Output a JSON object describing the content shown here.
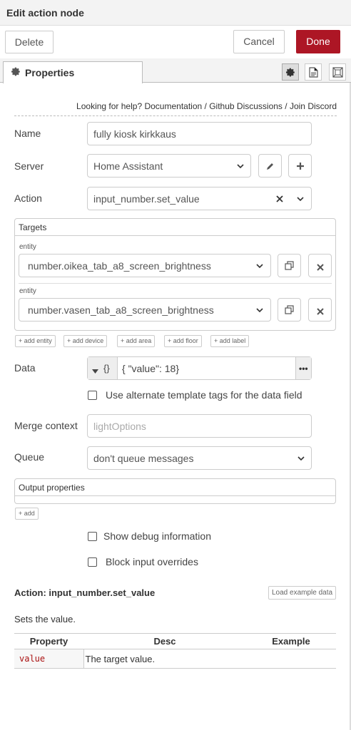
{
  "window": {
    "title": "Edit action node"
  },
  "toolbar": {
    "delete_label": "Delete",
    "cancel_label": "Cancel",
    "done_label": "Done"
  },
  "tabs": {
    "properties_label": "Properties"
  },
  "help": {
    "prefix": "Looking for help?",
    "documentation": "Documentation",
    "sep1": "/",
    "github": "Github Discussions",
    "sep2": "/",
    "discord": "Join Discord"
  },
  "form": {
    "name_label": "Name",
    "name_value": "fully kiosk kirkkaus",
    "server_label": "Server",
    "server_value": "Home Assistant",
    "action_label": "Action",
    "action_value": "input_number.set_value"
  },
  "targets": {
    "title": "Targets",
    "entities": [
      {
        "label": "entity",
        "value": "number.oikea_tab_a8_screen_brightness"
      },
      {
        "label": "entity",
        "value": "number.vasen_tab_a8_screen_brightness"
      }
    ],
    "add_buttons": [
      "add entity",
      "add device",
      "add area",
      "add floor",
      "add label"
    ]
  },
  "data_field": {
    "label": "Data",
    "type_symbol": "{}",
    "value": "{ \"value\": 18}",
    "alt_template_label": "Use alternate template tags for the data field"
  },
  "merge": {
    "label": "Merge context",
    "placeholder": "lightOptions"
  },
  "queue": {
    "label": "Queue",
    "value": "don't queue messages"
  },
  "output": {
    "title": "Output properties",
    "add_label": "add"
  },
  "options": {
    "debug_label": "Show debug information",
    "block_label": "Block input overrides"
  },
  "action_info": {
    "title": "Action: input_number.set_value",
    "load_example_label": "Load example data",
    "description": "Sets the value.",
    "columns": [
      "Property",
      "Desc",
      "Example"
    ],
    "rows": [
      {
        "property": "value",
        "desc": "The target value.",
        "example": ""
      }
    ]
  },
  "colors": {
    "done": "#ad1625",
    "code": "#aa1111"
  }
}
